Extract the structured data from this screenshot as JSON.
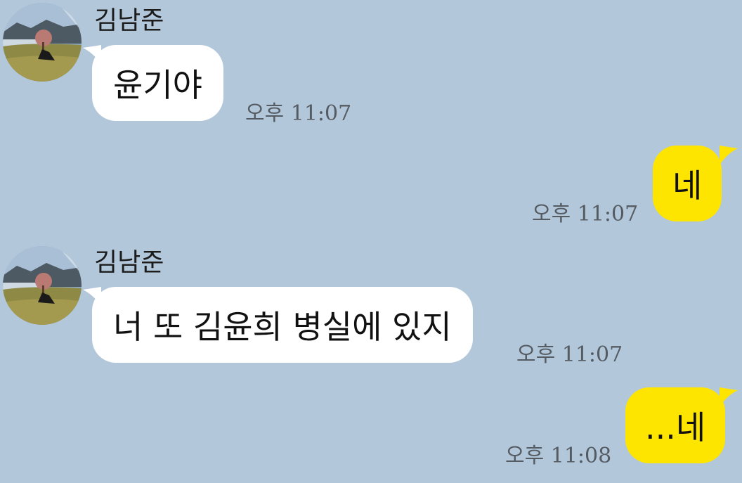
{
  "messages": [
    {
      "direction": "incoming",
      "sender": "김남준",
      "text": "윤기야",
      "time": "오후 11:07"
    },
    {
      "direction": "outgoing",
      "text": "네",
      "time": "오후 11:07"
    },
    {
      "direction": "incoming",
      "sender": "김남준",
      "text": "너 또 김윤희 병실에 있지",
      "time": "오후 11:07"
    },
    {
      "direction": "outgoing",
      "text": "...네",
      "time": "오후 11:08"
    }
  ],
  "colors": {
    "background": "#b2c7d9",
    "incoming_bubble": "#ffffff",
    "outgoing_bubble": "#fee500",
    "timestamp": "#555b62"
  },
  "icons": {
    "avatar": "profile-photo-landscape"
  }
}
